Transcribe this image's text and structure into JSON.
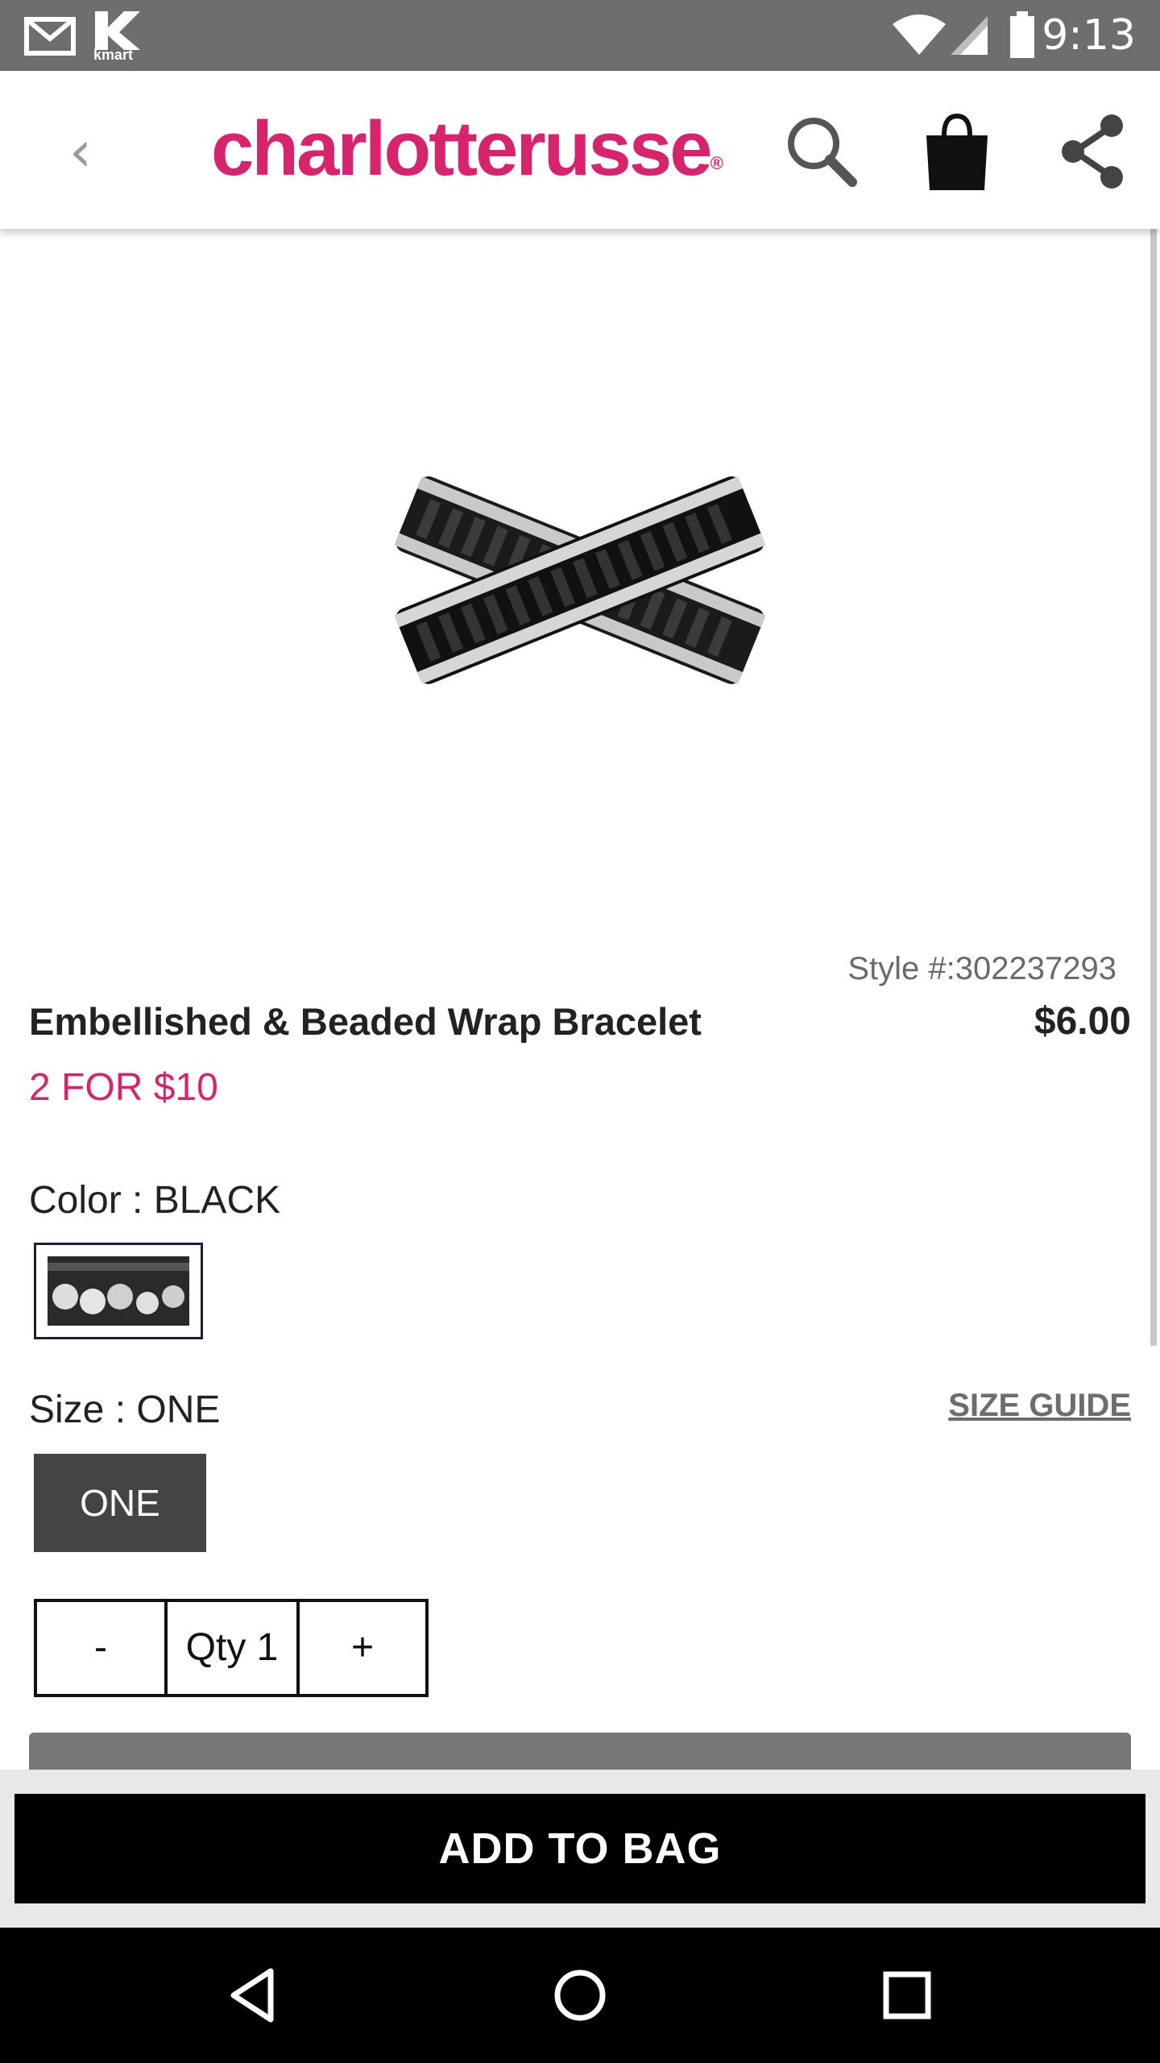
{
  "status_bar": {
    "time": "9:13",
    "left_icons": [
      "gmail-icon",
      "kmart-icon"
    ],
    "kmart_label": "kmart",
    "right_icons": [
      "wifi-icon",
      "signal-icon",
      "battery-icon"
    ]
  },
  "header": {
    "back_icon": "‹",
    "logo_text": "charlotterusse",
    "logo_mark": "®",
    "icons": [
      "search-icon",
      "shopping-bag-icon",
      "share-icon"
    ]
  },
  "product": {
    "style_number": "Style #:302237293",
    "title": "Embellished & Beaded Wrap Bracelet",
    "price": "$6.00",
    "promo": "2 FOR $10",
    "color_label": "Color : BLACK",
    "size_label": "Size : ONE",
    "size_guide": "SIZE GUIDE",
    "size_option": "ONE",
    "qty_minus": "-",
    "qty_value": "Qty 1",
    "qty_plus": "+",
    "add_to_bag": "ADD TO BAG"
  },
  "colors": {
    "brand": "#d6246e",
    "status_bar": "#6e6e6e",
    "size_button": "#444444",
    "add_button": "#000000"
  }
}
